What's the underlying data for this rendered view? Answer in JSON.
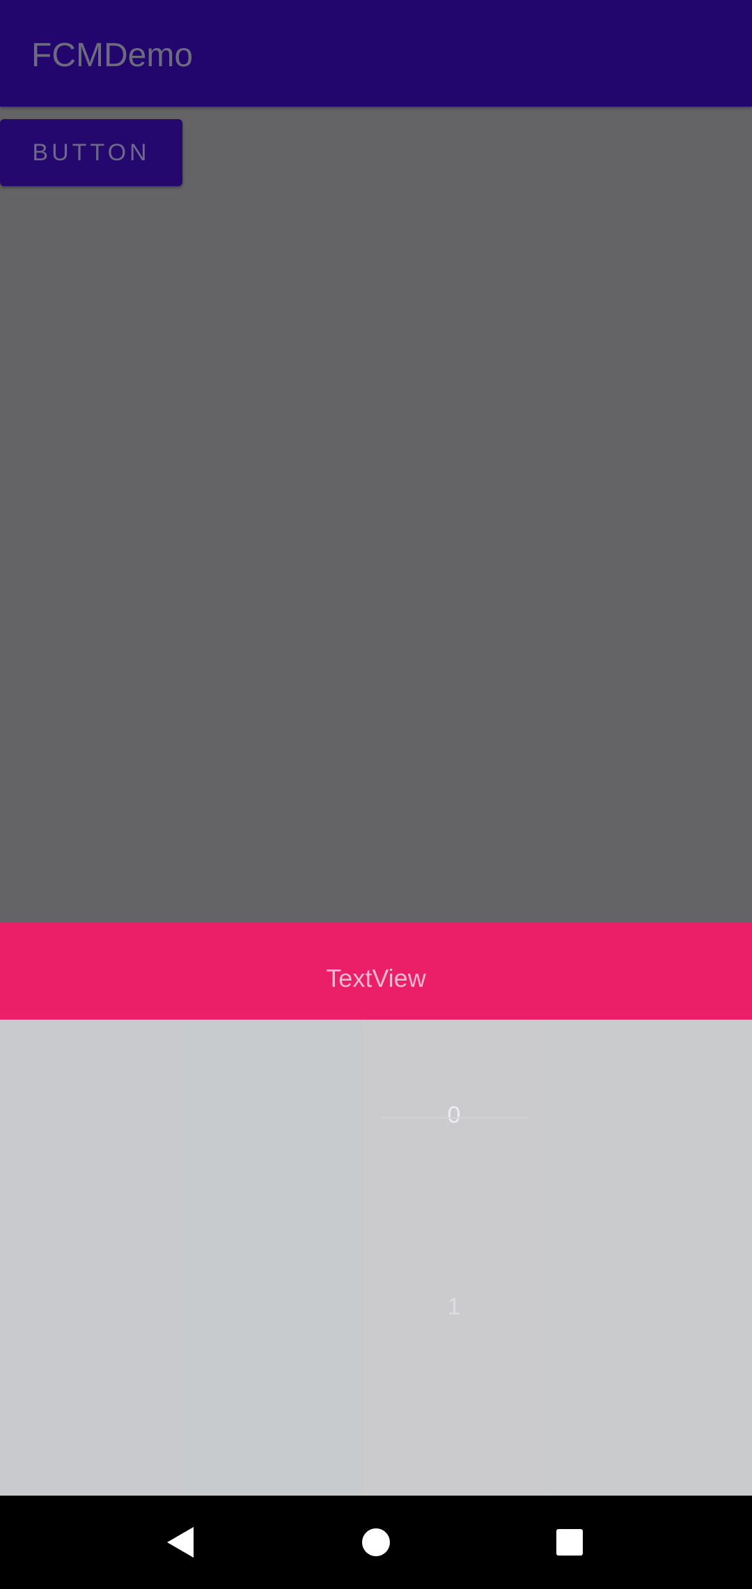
{
  "app_bar": {
    "title": "FCMDemo"
  },
  "main": {
    "button_label": "BUTTON"
  },
  "textview": {
    "label": "TextView"
  },
  "picker": {
    "values": [
      "0",
      "1",
      "-"
    ]
  },
  "nav_bar": {
    "back_icon": "back-triangle",
    "home_icon": "home-circle",
    "recents_icon": "recents-square"
  },
  "colors": {
    "app_bar": "#22066e",
    "button": "#24086e",
    "scrim_content": "#646466",
    "textview_bg": "#ea1f67",
    "picker_bg": "#cacacd",
    "nav_bar": "#000000"
  }
}
